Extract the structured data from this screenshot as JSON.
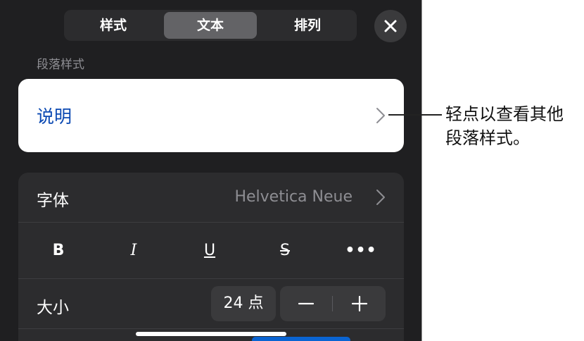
{
  "tabs": [
    {
      "label": "样式",
      "selected": false
    },
    {
      "label": "文本",
      "selected": true
    },
    {
      "label": "排列",
      "selected": false
    }
  ],
  "close_icon": "close-icon",
  "paragraph_style": {
    "section_title": "段落样式",
    "current_style": "说明"
  },
  "font": {
    "label": "字体",
    "value": "Helvetica Neue"
  },
  "format_buttons": {
    "bold": "B",
    "italic": "I",
    "underline": "U",
    "strikethrough": "S",
    "more": "•••"
  },
  "size": {
    "label": "大小",
    "value": "24 点"
  },
  "callout": {
    "line1": "轻点以查看其他",
    "line2": "段落样式。"
  },
  "colors": {
    "panel_bg": "#1f1f21",
    "accent_blue": "#0a48b2",
    "selected_tab": "#636366"
  }
}
